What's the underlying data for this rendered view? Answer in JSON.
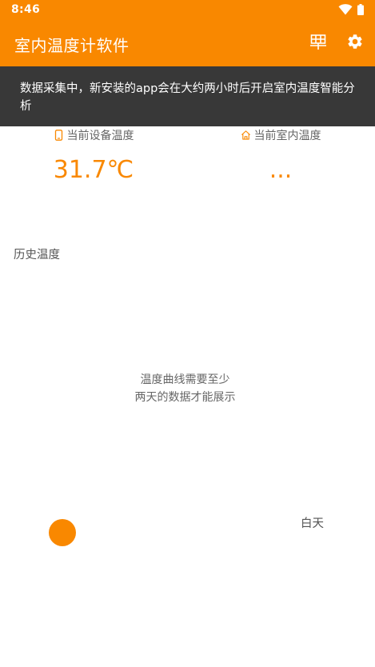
{
  "status_bar": {
    "time": "8:46",
    "icons": [
      "wifi-icon",
      "battery-icon"
    ]
  },
  "app_bar": {
    "title": "室内温度计软件",
    "actions": [
      "chart-icon",
      "gear-icon"
    ]
  },
  "toast": {
    "message": "数据采集中，新安装的app会在大约两小时后开启室内温度智能分析"
  },
  "device_temp": {
    "label": "当前设备温度",
    "value": "31.7℃",
    "icon": "phone-icon"
  },
  "indoor_temp": {
    "label": "当前室内温度",
    "value": "...",
    "icon": "home-icon"
  },
  "history": {
    "title": "历史温度",
    "empty_line1": "温度曲线需要至少",
    "empty_line2": "两天的数据才能展示",
    "day_label": "白天"
  },
  "colors": {
    "accent": "#f98800",
    "toast_bg": "#383838"
  }
}
